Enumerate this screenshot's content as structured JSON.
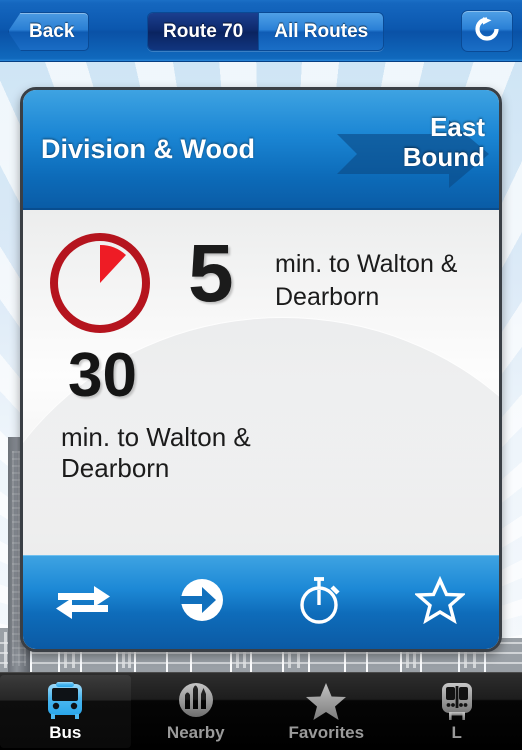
{
  "navbar": {
    "back_label": "Back",
    "refresh_icon": "refresh-icon",
    "segments": [
      {
        "label": "Route 70",
        "selected": true
      },
      {
        "label": "All Routes",
        "selected": false
      }
    ]
  },
  "card": {
    "stop_name": "Division & Wood",
    "direction_line1": "East",
    "direction_line2": "Bound",
    "direction_arrow_icon": "right-arrow-banner-icon",
    "arrivals": [
      {
        "icon": "clock-icon",
        "minutes": "5",
        "destination": "min. to Walton & Dearborn"
      },
      {
        "minutes": "30",
        "destination": "min. to Walton & Dearborn"
      }
    ],
    "toolbar": [
      {
        "icon": "swap-direction-icon",
        "name": "reverse-direction-button"
      },
      {
        "icon": "arrow-into-circle-icon",
        "name": "go-to-stop-button"
      },
      {
        "icon": "stopwatch-icon",
        "name": "schedule-button"
      },
      {
        "icon": "star-outline-icon",
        "name": "add-favorite-button"
      }
    ]
  },
  "tabbar": {
    "tabs": [
      {
        "label": "Bus",
        "icon": "bus-icon",
        "active": true
      },
      {
        "label": "Nearby",
        "icon": "skyline-circle-icon",
        "active": false
      },
      {
        "label": "Favorites",
        "icon": "star-icon",
        "active": false
      },
      {
        "label": "L",
        "icon": "train-icon",
        "active": false
      }
    ]
  },
  "colors": {
    "nav_blue": "#0b57ae",
    "card_blue": "#1b86d4",
    "selected_segment": "#0e2a6e",
    "clock_red": "#b5141e",
    "clock_hand_red": "#ee1c25",
    "tab_active_blue": "#4db8f0",
    "sky": "#dceaf7"
  }
}
